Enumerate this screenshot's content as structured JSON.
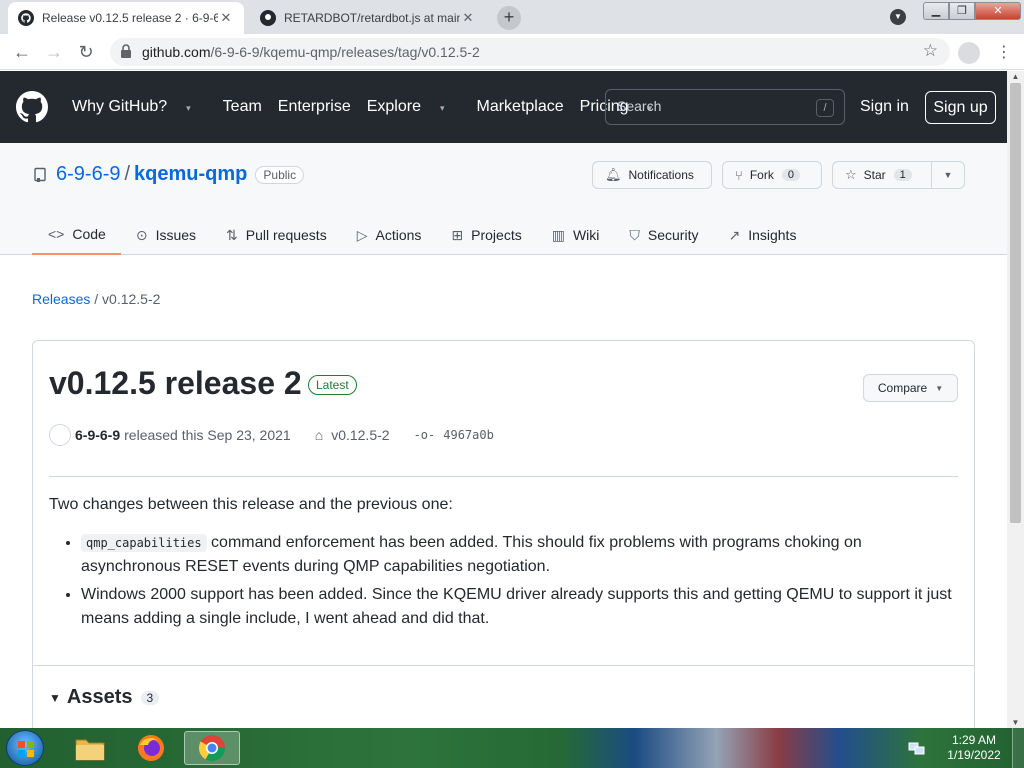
{
  "browser": {
    "tabs": [
      {
        "title": "Release v0.12.5 release 2 · 6-9-6-",
        "active": true
      },
      {
        "title": "RETARDBOT/retardbot.js at main",
        "active": false
      }
    ],
    "newtab_label": "+",
    "url_host": "github.com",
    "url_path": "/6-9-6-9/kqemu-qmp/releases/tag/v0.12.5-2"
  },
  "github": {
    "nav": [
      "Why GitHub?",
      "Team",
      "Enterprise",
      "Explore",
      "Marketplace",
      "Pricing"
    ],
    "search_placeholder": "Search",
    "search_key": "/",
    "signin": "Sign in",
    "signup": "Sign up"
  },
  "repo": {
    "owner": "6-9-6-9",
    "separator": "/",
    "name": "kqemu-qmp",
    "visibility": "Public",
    "notifications_label": "Notifications",
    "fork_label": "Fork",
    "fork_count": "0",
    "star_label": "Star",
    "star_count": "1",
    "tabs": [
      "Code",
      "Issues",
      "Pull requests",
      "Actions",
      "Projects",
      "Wiki",
      "Security",
      "Insights"
    ]
  },
  "breadcrumb": {
    "root": "Releases",
    "sep": "/",
    "current": "v0.12.5-2"
  },
  "release": {
    "title": "v0.12.5 release 2",
    "badge": "Latest",
    "compare_label": "Compare",
    "author": "6-9-6-9",
    "released_text": "released this Sep 23, 2021",
    "tag": "v0.12.5-2",
    "commit": "4967a0b",
    "intro": "Two changes between this release and the previous one:",
    "bullet1_code": "qmp_capabilities",
    "bullet1_text": " command enforcement has been added. This should fix problems with programs choking on asynchronous RESET events during QMP capabilities negotiation.",
    "bullet2_text": "Windows 2000 support has been added. Since the KQEMU driver already supports this and getting QEMU to support it just means adding a single include, I went ahead and did that.",
    "assets_label": "Assets",
    "assets_count": "3"
  },
  "taskbar": {
    "time": "1:29 AM",
    "date": "1/19/2022"
  },
  "colors": {
    "github_header": "#24292f",
    "link": "#0969da",
    "latest_green": "#1a7f37",
    "active_tab_underline": "#fd8c73"
  }
}
